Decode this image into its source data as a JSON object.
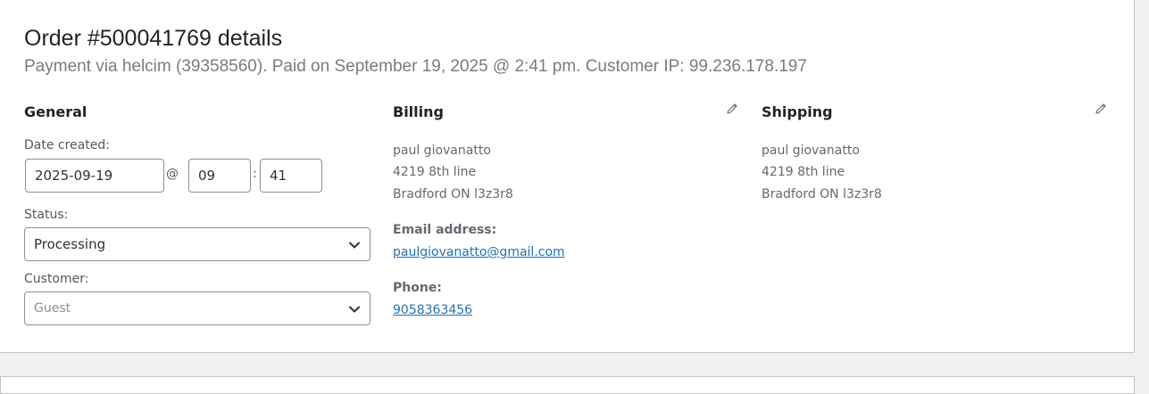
{
  "order": {
    "title": "Order #500041769 details",
    "meta": "Payment via helcim (39358560). Paid on September 19, 2025 @ 2:41 pm. Customer IP: 99.236.178.197"
  },
  "general": {
    "heading": "General",
    "date_label": "Date created:",
    "date_value": "2025-09-19",
    "at_sep": "@",
    "hour_value": "09",
    "colon_sep": ":",
    "minute_value": "41",
    "status_label": "Status:",
    "status_value": "Processing",
    "customer_label": "Customer:",
    "customer_placeholder": "Guest"
  },
  "billing": {
    "heading": "Billing",
    "edit_icon": "pencil-icon",
    "name": "paul giovanatto",
    "address1": "4219 8th line",
    "city_line": "Bradford ON l3z3r8",
    "email_label": "Email address:",
    "email": "paulgiovanatto@gmail.com",
    "phone_label": "Phone:",
    "phone": "9058363456"
  },
  "shipping": {
    "heading": "Shipping",
    "edit_icon": "pencil-icon",
    "name": "paul giovanatto",
    "address1": "4219 8th line",
    "city_line": "Bradford ON l3z3r8"
  },
  "colors": {
    "link": "#2271b1",
    "border": "#c3c4c7",
    "background": "#f0f0f1"
  }
}
